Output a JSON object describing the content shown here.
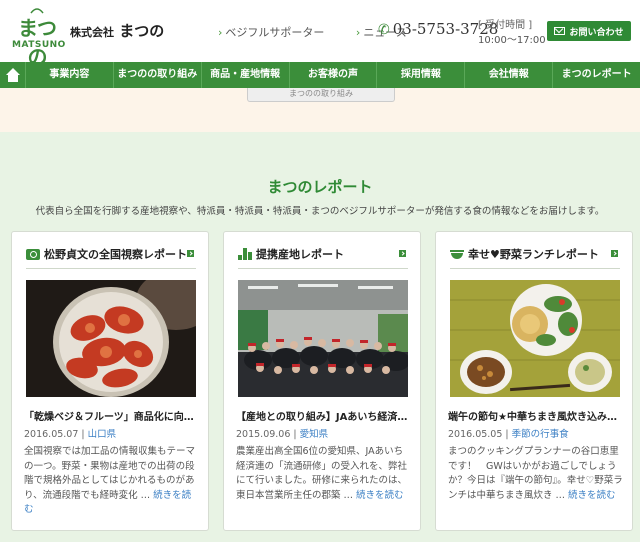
{
  "header": {
    "logo_jp": "まつの",
    "logo_en": "MATSUNO",
    "company_prefix": "株式会社",
    "company_name": "まつの",
    "links": [
      "ベジフルサポーター",
      "ニュース"
    ],
    "phone": "03-5753-3728",
    "hours_label": "[ 受付時間 ]",
    "hours_time": "10:00～17:00",
    "contact_label": "お問い合わせ"
  },
  "nav": {
    "items": [
      "事業内容",
      "まつのの取り組み",
      "商品・産地情報",
      "お客様の声",
      "採用情報",
      "会社情報",
      "まつのレポート"
    ]
  },
  "peach_button": "まつのの取り組み",
  "section": {
    "title": "まつのレポート",
    "description": "代表自ら全国を行脚する産地視察や、特派員・特派員・特派員・まつのベジフルサポーターが発信する食の情報などをお届けします。"
  },
  "cards": [
    {
      "title": "松野貞文の全国視察レポート",
      "headline": "「乾燥ベジ＆フルーツ」商品化に向…",
      "date": "2016.05.07",
      "tag": "山口県",
      "body": "全国視察では加工品の情報収集もテーマの一つ。野菜・果物は産地での出荷の段階で規格外品としてはじかれるものがあり、流通段階でも経時変化 … ",
      "more": "続きを読む"
    },
    {
      "title": "提携産地レポート",
      "headline": "【産地との取り組み】JAあいち経済…",
      "date": "2015.09.06",
      "tag": "愛知県",
      "body": "農業産出高全国6位の愛知県、JAあいち経済連の「流通研修」の受入れを、弊社にて行いました。研修に来られたのは、東日本営業所主任の郡築 … ",
      "more": "続きを読む"
    },
    {
      "title": "幸せ♥野菜ランチレポート",
      "headline": "端午の節句★中華ちまき風炊き込み…",
      "date": "2016.05.05",
      "tag": "季節の行事食",
      "body": "まつのクッキングプランナーの谷口恵里です！　GWはいかがお過ごしでしょうか？今日は『端午の節句』。幸せ♡野菜ランチは中華ちまき風炊き … ",
      "more": "続きを読む"
    }
  ],
  "colors": {
    "brand_green": "#3b8e3a",
    "link_blue": "#3b7fc4",
    "section_bg": "#e8f3e4",
    "peach_bg": "#fdf4e9"
  }
}
